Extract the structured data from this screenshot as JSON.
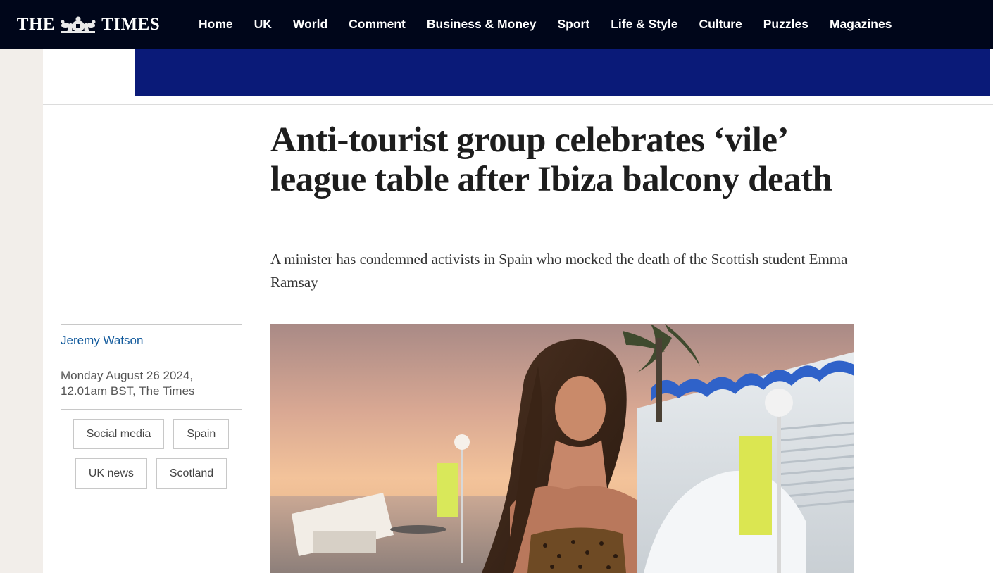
{
  "logo": {
    "text_left": "THE",
    "text_right": "TIMES",
    "crest_icon": "royal-crest-icon"
  },
  "nav": {
    "items": [
      {
        "label": "Home"
      },
      {
        "label": "UK"
      },
      {
        "label": "World"
      },
      {
        "label": "Comment"
      },
      {
        "label": "Business & Money"
      },
      {
        "label": "Sport"
      },
      {
        "label": "Life & Style"
      },
      {
        "label": "Culture"
      },
      {
        "label": "Puzzles"
      },
      {
        "label": "Magazines"
      }
    ]
  },
  "colors": {
    "nav_background": "#00061a",
    "ad_banner": "#0a1a78",
    "author_link": "#125a9c"
  },
  "article": {
    "headline": "Anti-tourist group celebrates ‘vile’ league table after Ibiza balcony death",
    "standfirst": "A minister has condemned activists in Spain who mocked the death of the Scottish student Emma Ramsay",
    "author": "Jeremy Watson",
    "dateline": "Monday August 26 2024, 12.01am BST, The Times",
    "tags": [
      {
        "label": "Social media"
      },
      {
        "label": "Spain"
      },
      {
        "label": "UK news"
      },
      {
        "label": "Scotland"
      }
    ]
  }
}
